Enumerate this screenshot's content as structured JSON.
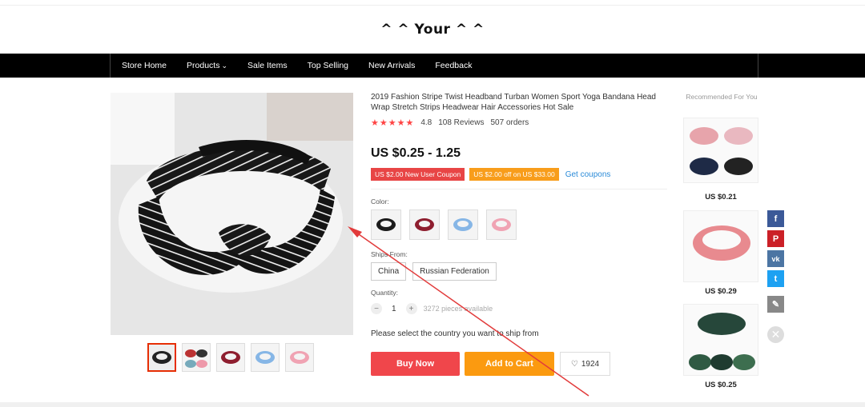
{
  "store": {
    "title": "^ ^ Your ^ ^"
  },
  "nav": {
    "items": [
      "Store Home",
      "Products",
      "Sale Items",
      "Top Selling",
      "New Arrivals",
      "Feedback"
    ]
  },
  "product": {
    "title": "2019 Fashion Stripe Twist Headband Turban Women Sport Yoga Bandana Head Wrap Stretch Strips Headwear Hair Accessories Hot Sale",
    "rating": "4.8",
    "reviews": "108 Reviews",
    "orders": "507 orders",
    "price": "US $0.25 - 1.25",
    "coupons": [
      {
        "text": "US $2.00 New User Coupon",
        "color": "#e84545"
      },
      {
        "text": "US $2.00 off on US $33.00",
        "color": "#f89d1b"
      }
    ],
    "get_coupons": "Get coupons",
    "color_label": "Color:",
    "ship_label": "Ships From:",
    "ship_options": [
      "China",
      "Russian Federation"
    ],
    "quantity_label": "Quantity:",
    "quantity_value": "1",
    "quantity_available": "3272 pieces available",
    "ship_message": "Please select the country you want to ship from",
    "buy_now": "Buy Now",
    "add_to_cart": "Add to Cart",
    "wishlist_count": "1924"
  },
  "recommended": {
    "title": "Recommended For You",
    "items": [
      {
        "price": "US $0.21"
      },
      {
        "price": "US $0.29"
      },
      {
        "price": "US $0.25"
      }
    ]
  },
  "social": {
    "facebook_color": "#3b5998",
    "pinterest_color": "#cb2027",
    "vk_color": "#4c75a3",
    "twitter_color": "#1da1f2",
    "edit_color": "#888888"
  },
  "annotation": {
    "arrow_color": "#e23b3b"
  }
}
